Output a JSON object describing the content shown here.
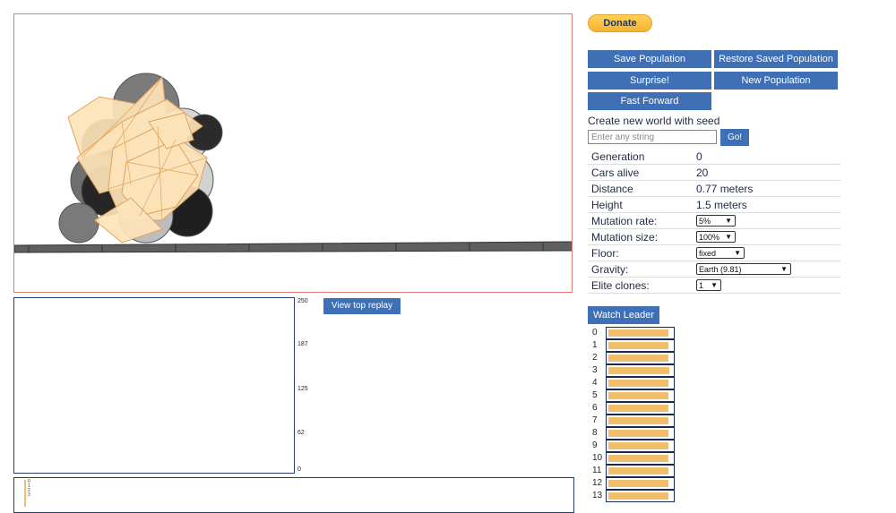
{
  "colors": {
    "accent": "#3f6fb5",
    "health_fill": "#f1be6c",
    "world_border": "#e07b7b",
    "car_body": "#fde3b8"
  },
  "world": {
    "floor": "fixed"
  },
  "graph": {
    "y_ticks": [
      "250",
      "187",
      "125",
      "62",
      "0"
    ],
    "replay_label": "View top replay"
  },
  "minimap": {
    "labels": [
      "0",
      "1",
      "2",
      "3"
    ]
  },
  "panel": {
    "donate_label": "Donate",
    "buttons": {
      "save": "Save Population",
      "restore": "Restore Saved Population",
      "surprise": "Surprise!",
      "new_population": "New Population",
      "fast_forward": "Fast Forward"
    },
    "seed": {
      "label": "Create new world with seed",
      "placeholder": "Enter any string",
      "go_label": "Go!"
    },
    "stats": [
      {
        "key": "Generation",
        "value": "0"
      },
      {
        "key": "Cars alive",
        "value": "20"
      },
      {
        "key": "Distance",
        "value": "0.77 meters"
      },
      {
        "key": "Height",
        "value": "1.5 meters"
      }
    ],
    "settings": [
      {
        "key": "Mutation rate:",
        "value": "5%"
      },
      {
        "key": "Mutation size:",
        "value": "100%"
      },
      {
        "key": "Floor:",
        "value": "fixed"
      },
      {
        "key": "Gravity:",
        "value": "Earth (9.81)"
      },
      {
        "key": "Elite clones:",
        "value": "1"
      }
    ],
    "watch_leader_label": "Watch Leader",
    "health": [
      {
        "label": "0",
        "level": 0.93
      },
      {
        "label": "1",
        "level": 0.93
      },
      {
        "label": "2",
        "level": 0.93
      },
      {
        "label": "3",
        "level": 0.95
      },
      {
        "label": "4",
        "level": 0.93
      },
      {
        "label": "5",
        "level": 0.93
      },
      {
        "label": "6",
        "level": 0.93
      },
      {
        "label": "7",
        "level": 0.93
      },
      {
        "label": "8",
        "level": 0.93
      },
      {
        "label": "9",
        "level": 0.93
      },
      {
        "label": "10",
        "level": 0.93
      },
      {
        "label": "11",
        "level": 0.93
      },
      {
        "label": "12",
        "level": 0.93
      },
      {
        "label": "13",
        "level": 0.93
      }
    ]
  }
}
